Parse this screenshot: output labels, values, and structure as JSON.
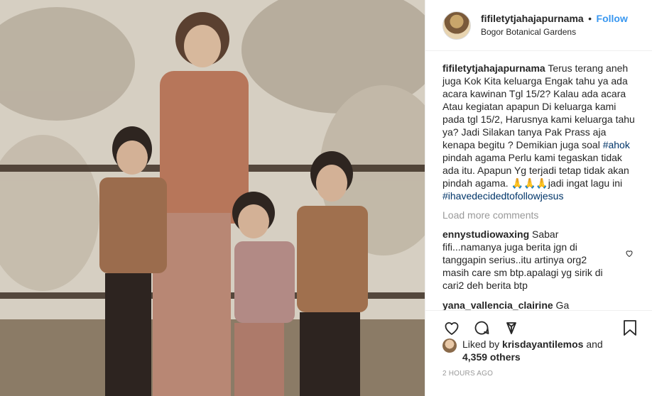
{
  "post": {
    "username": "fifiletytjahajapurnama",
    "separator": "•",
    "follow_label": "Follow",
    "location": "Bogor Botanical Gardens"
  },
  "caption": {
    "username": "fifiletytjahajapurnama",
    "text_1": " Terus terang aneh juga Kok Kita keluarga Engak tahu ya ada acara kawinan Tgl 15/2? Kalau ada acara Atau kegiatan apapun Di keluarga kami pada tgl 15/2, Harusnya kami keluarga tahu ya? Jadi Silakan tanya Pak Prass aja kenapa begitu ? Demikian juga soal ",
    "hashtag_1": "#ahok",
    "text_2": " pindah agama Perlu kami tegaskan tidak ada itu. Apapun Yg terjadi tetap tidak akan pindah agama. 🙏🙏🙏jadi ingat lagu ini ",
    "hashtag_2": "#ihavedecidedtofollowjesus"
  },
  "load_more_label": "Load more comments",
  "comments": [
    {
      "username": "ennystudiowaxing",
      "text": " Sabar fifi...namanya juga berita jgn di tanggapin serius..itu artinya org2 masih care sm btp.apalagi yg sirik di cari2 deh berita btp"
    },
    {
      "username": "yana_vallencia_clairine",
      "text": " Ga nyangka.setelah besar anak anak ini"
    }
  ],
  "icons": {
    "like": "heart-icon",
    "comment": "comment-icon",
    "share": "share-icon",
    "save": "bookmark-icon",
    "comment_like": "small-heart-icon"
  },
  "likes": {
    "prefix": "Liked by ",
    "liker": "krisdayantilemos",
    "and": " and",
    "count": "4,359 others"
  },
  "timestamp": "2 HOURS AGO",
  "colors": {
    "link": "#3897f0",
    "hashtag": "#003569",
    "muted": "#999999",
    "text": "#262626"
  }
}
